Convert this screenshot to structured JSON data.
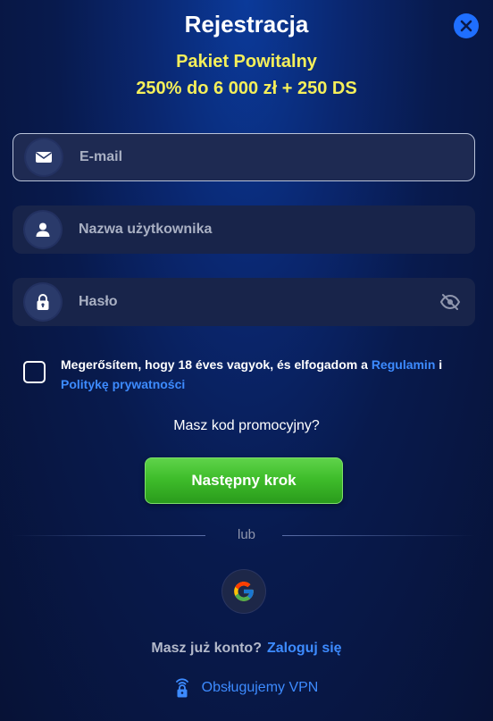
{
  "header": {
    "title": "Rejestracja",
    "close_icon": "close-icon"
  },
  "promo": {
    "title": "Pakiet Powitalny",
    "subtitle": "250% do 6 000 zł + 250 DS"
  },
  "form": {
    "email": {
      "placeholder": "E-mail",
      "value": "",
      "icon": "envelope-icon"
    },
    "username": {
      "placeholder": "Nazwa użytkownika",
      "value": "",
      "icon": "user-icon"
    },
    "password": {
      "placeholder": "Hasło",
      "value": "",
      "icon": "lock-icon",
      "toggle_icon": "eye-off-icon"
    }
  },
  "terms": {
    "checked": false,
    "text_before": "Megerősítem, hogy 18 éves vagyok, és elfogadom a ",
    "link_regulamin": "Regulamin",
    "text_and": " i ",
    "link_privacy": "Politykę prywatności"
  },
  "promo_code_label": "Masz kod promocyjny?",
  "next_button": "Następny krok",
  "divider_label": "lub",
  "social": {
    "google_icon": "google-icon"
  },
  "login": {
    "question": "Masz już konto?",
    "link": "Zaloguj się"
  },
  "vpn": {
    "label": "Obsługujemy VPN",
    "icon": "wifi-lock-icon"
  },
  "colors": {
    "accent_yellow": "#f5ef5a",
    "link_blue": "#3d8bff",
    "button_green": "#3fbd2b",
    "close_blue": "#1f6fff"
  }
}
